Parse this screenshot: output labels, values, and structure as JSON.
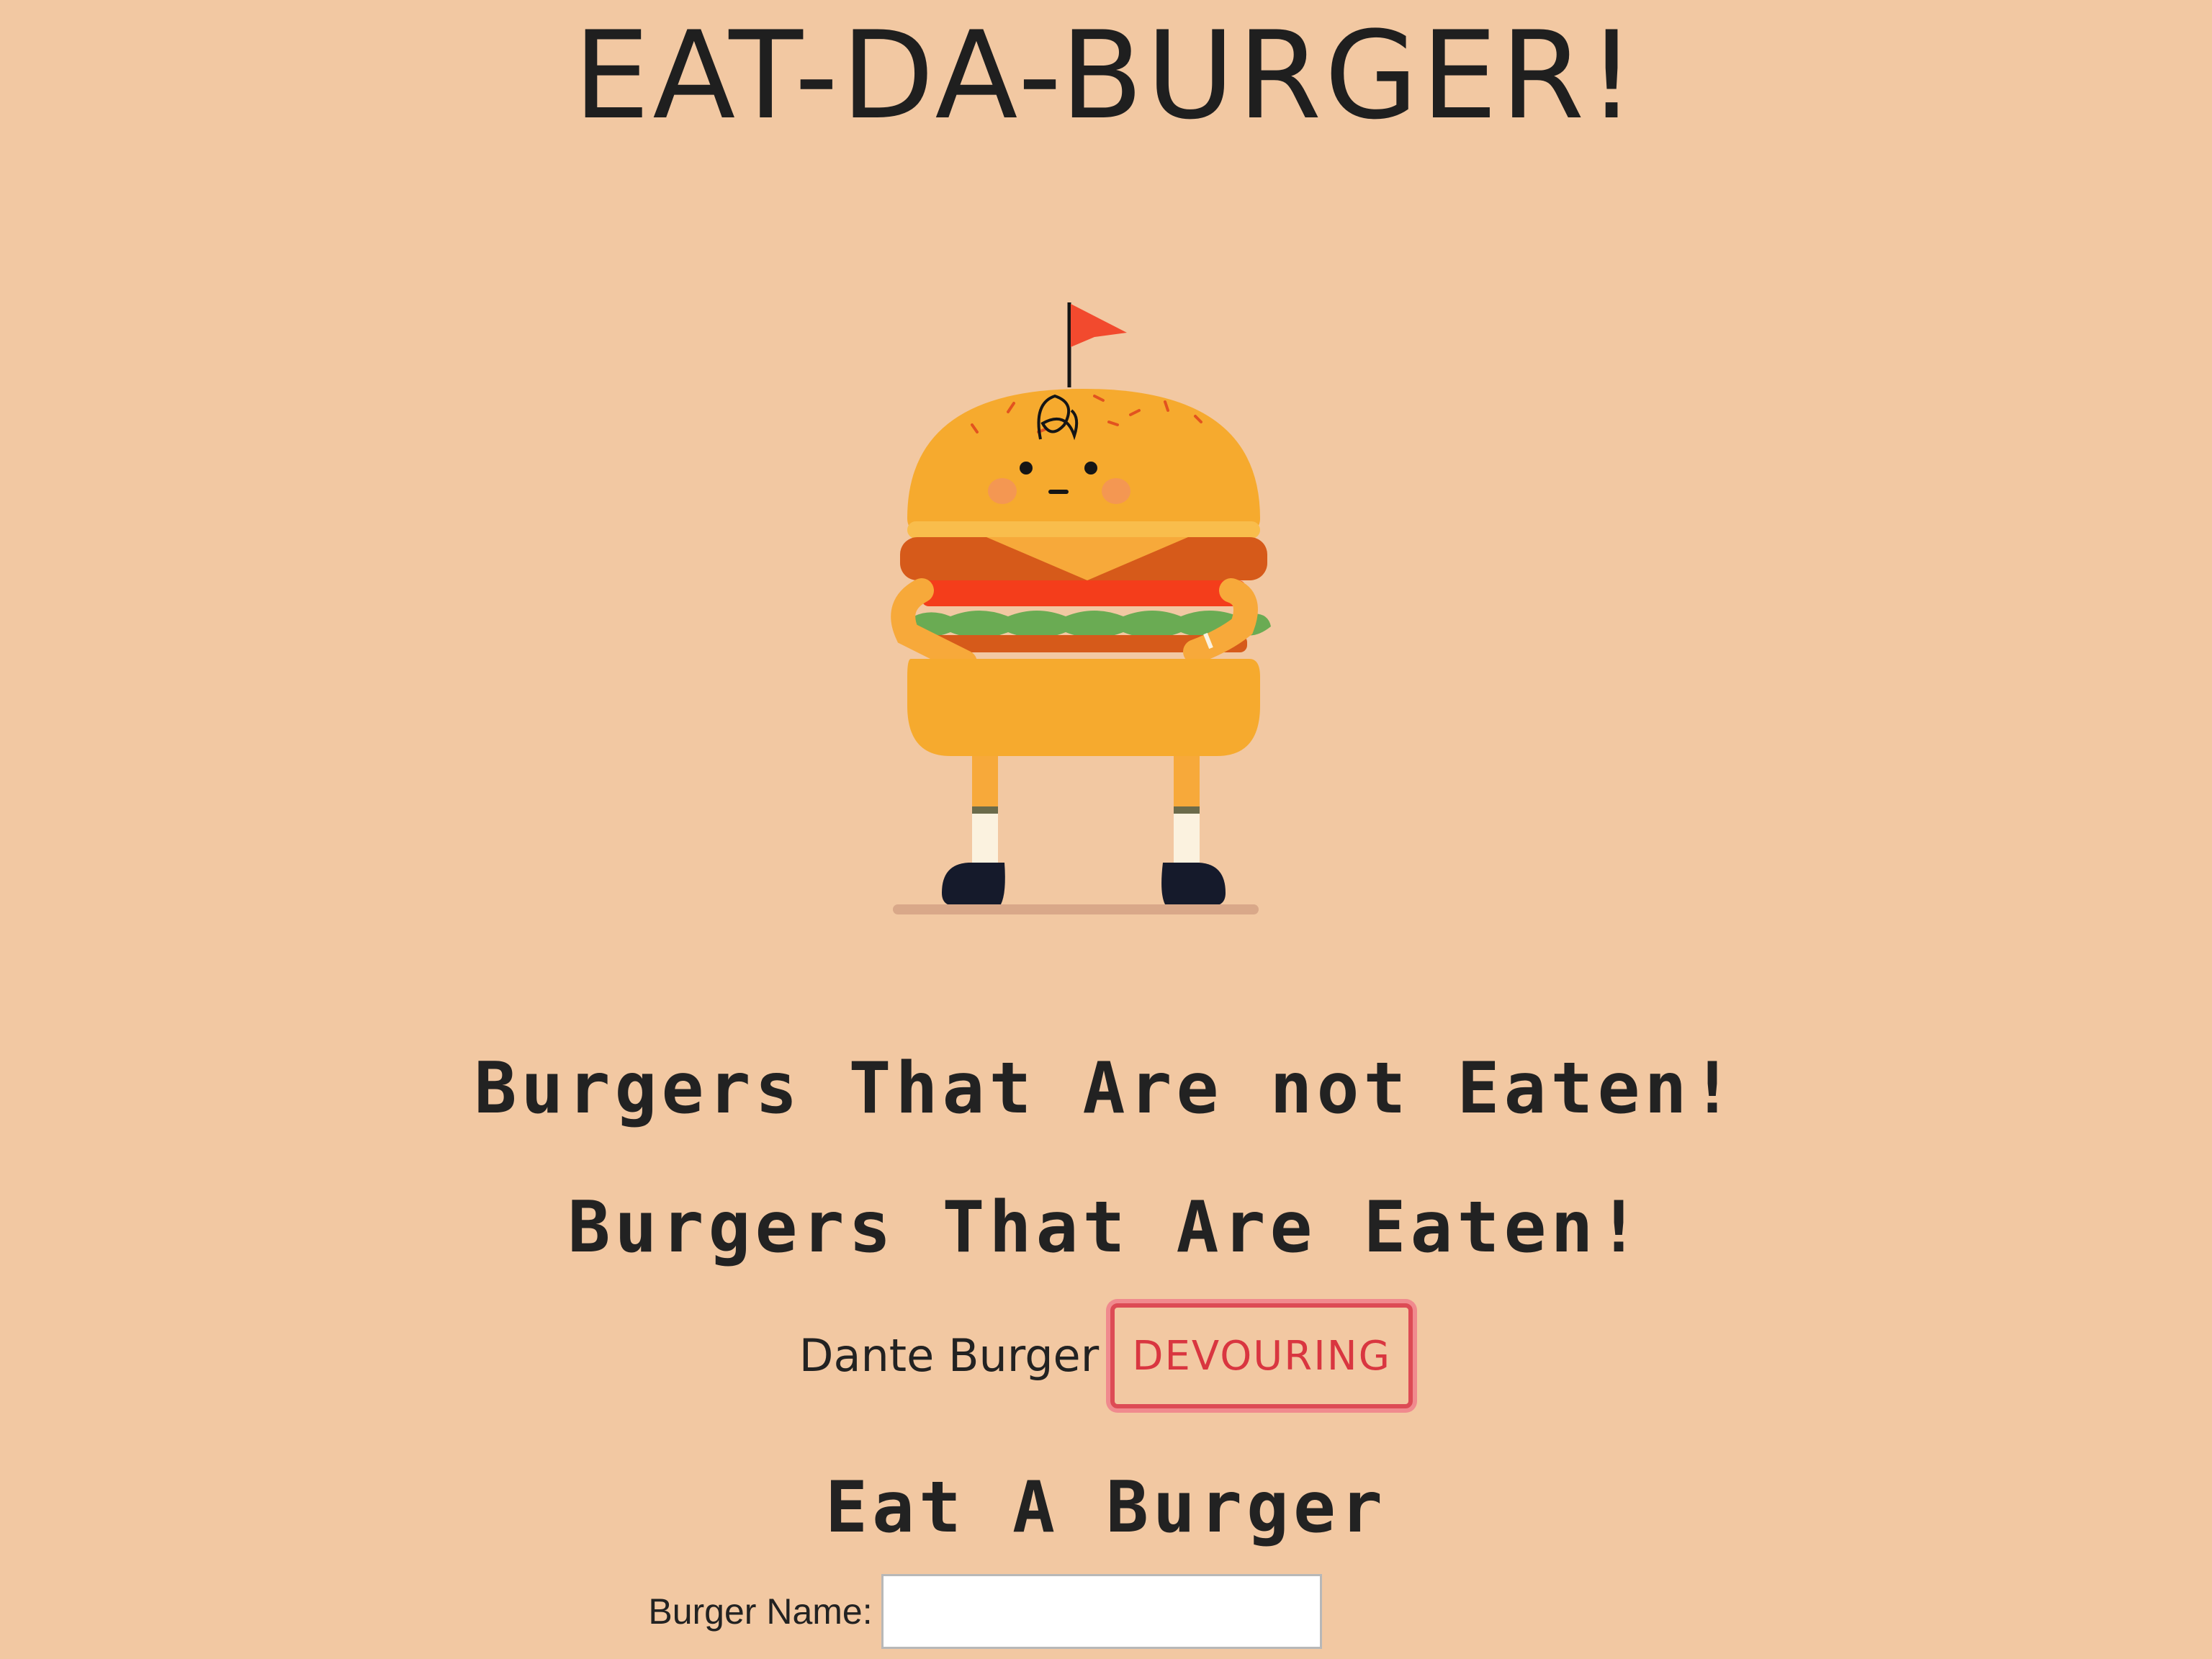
{
  "page": {
    "title": "EAT-DA-BURGER!",
    "background": "#f2c8a2"
  },
  "mascot": {
    "icon": "burger-mascot-icon"
  },
  "not_eaten": {
    "heading": "Burgers That Are not Eaten!"
  },
  "eaten": {
    "heading": "Burgers That Are Eaten!",
    "items": [
      {
        "name": "Dante Burger",
        "button_label": "DEVOURING"
      }
    ]
  },
  "form": {
    "heading": "Eat A Burger",
    "label": "Burger Name:",
    "value": ""
  },
  "colors": {
    "button_border": "#dd4b55",
    "button_text": "#d93640"
  }
}
